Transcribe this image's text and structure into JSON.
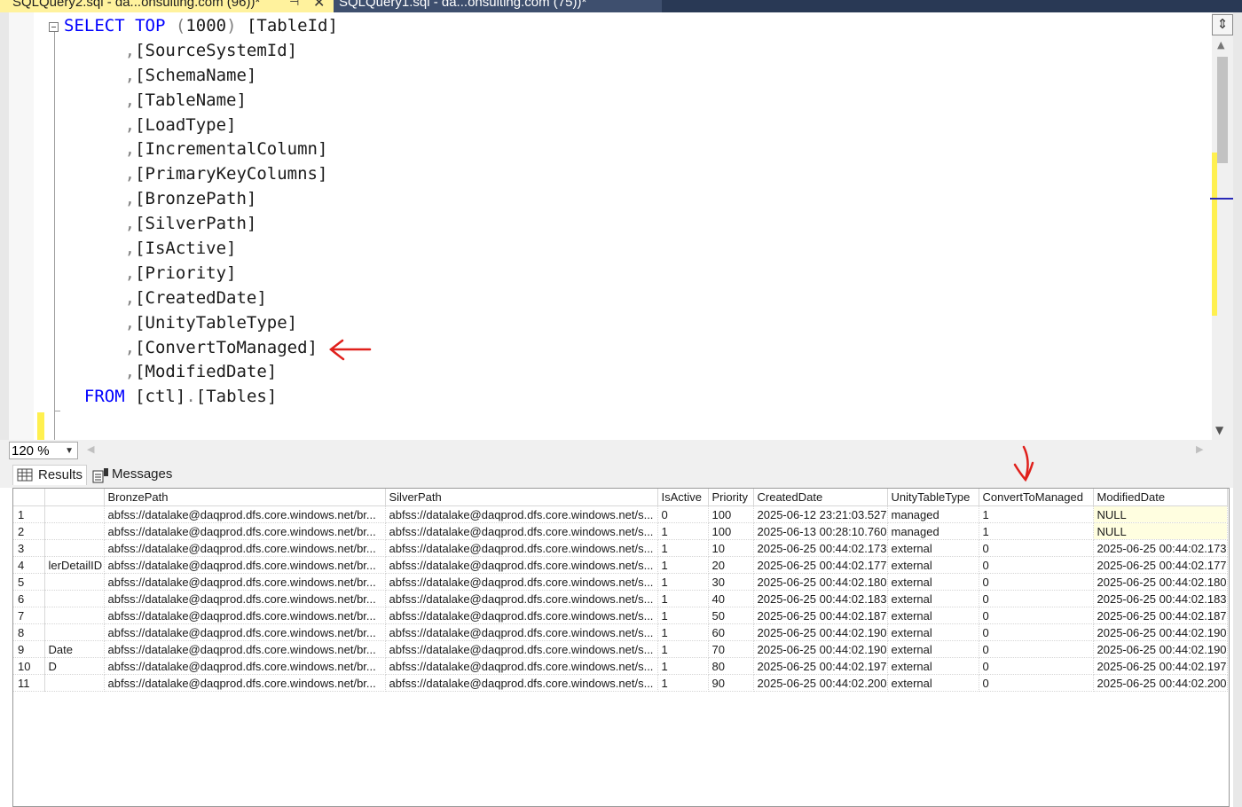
{
  "tabs": {
    "active": {
      "title": "SQLQuery2.sql - da...onsulting.com (96))*",
      "pin": "⊣",
      "close": "✕"
    },
    "inactive": {
      "title": "SQLQuery1.sql - da...onsulting.com (75))*"
    }
  },
  "editor": {
    "lines": [
      {
        "kw": "SELECT",
        "mid": " ",
        "kw2": "TOP",
        "gray": " (",
        "text": "1000",
        "gray2": ")",
        "tail": " [TableId]",
        "indent": ""
      },
      {
        "comma": ",",
        "text": "[SourceSystemId]"
      },
      {
        "comma": ",",
        "text": "[SchemaName]"
      },
      {
        "comma": ",",
        "text": "[TableName]"
      },
      {
        "comma": ",",
        "text": "[LoadType]"
      },
      {
        "comma": ",",
        "text": "[IncrementalColumn]"
      },
      {
        "comma": ",",
        "text": "[PrimaryKeyColumns]"
      },
      {
        "comma": ",",
        "text": "[BronzePath]"
      },
      {
        "comma": ",",
        "text": "[SilverPath]"
      },
      {
        "comma": ",",
        "text": "[IsActive]"
      },
      {
        "comma": ",",
        "text": "[Priority]"
      },
      {
        "comma": ",",
        "text": "[CreatedDate]"
      },
      {
        "comma": ",",
        "text": "[UnityTableType]"
      },
      {
        "comma": ",",
        "text": "[ConvertToManaged]"
      },
      {
        "comma": ",",
        "text": "[ModifiedDate]"
      },
      {
        "kw": "FROM",
        "text": "[ctl]",
        "dot": ".",
        "text2": "[Tables]"
      }
    ],
    "zoom": "120 %"
  },
  "results": {
    "tabs": {
      "results": "Results",
      "messages": "Messages"
    },
    "columns": [
      "",
      "",
      "BronzePath",
      "SilverPath",
      "IsActive",
      "Priority",
      "CreatedDate",
      "UnityTableType",
      "ConvertToManaged",
      "ModifiedDate"
    ],
    "rows": [
      [
        "1",
        "",
        "abfss://datalake@daqprod.dfs.core.windows.net/br...",
        "abfss://datalake@daqprod.dfs.core.windows.net/s...",
        "0",
        "100",
        "2025-06-12 23:21:03.527",
        "managed",
        "1",
        "NULL"
      ],
      [
        "2",
        "",
        "abfss://datalake@daqprod.dfs.core.windows.net/br...",
        "abfss://datalake@daqprod.dfs.core.windows.net/s...",
        "1",
        "100",
        "2025-06-13 00:28:10.760",
        "managed",
        "1",
        "NULL"
      ],
      [
        "3",
        "",
        "abfss://datalake@daqprod.dfs.core.windows.net/br...",
        "abfss://datalake@daqprod.dfs.core.windows.net/s...",
        "1",
        "10",
        "2025-06-25 00:44:02.173",
        "external",
        "0",
        "2025-06-25 00:44:02.173"
      ],
      [
        "4",
        "lerDetailID",
        "abfss://datalake@daqprod.dfs.core.windows.net/br...",
        "abfss://datalake@daqprod.dfs.core.windows.net/s...",
        "1",
        "20",
        "2025-06-25 00:44:02.177",
        "external",
        "0",
        "2025-06-25 00:44:02.177"
      ],
      [
        "5",
        "",
        "abfss://datalake@daqprod.dfs.core.windows.net/br...",
        "abfss://datalake@daqprod.dfs.core.windows.net/s...",
        "1",
        "30",
        "2025-06-25 00:44:02.180",
        "external",
        "0",
        "2025-06-25 00:44:02.180"
      ],
      [
        "6",
        "",
        "abfss://datalake@daqprod.dfs.core.windows.net/br...",
        "abfss://datalake@daqprod.dfs.core.windows.net/s...",
        "1",
        "40",
        "2025-06-25 00:44:02.183",
        "external",
        "0",
        "2025-06-25 00:44:02.183"
      ],
      [
        "7",
        "",
        "abfss://datalake@daqprod.dfs.core.windows.net/br...",
        "abfss://datalake@daqprod.dfs.core.windows.net/s...",
        "1",
        "50",
        "2025-06-25 00:44:02.187",
        "external",
        "0",
        "2025-06-25 00:44:02.187"
      ],
      [
        "8",
        "",
        "abfss://datalake@daqprod.dfs.core.windows.net/br...",
        "abfss://datalake@daqprod.dfs.core.windows.net/s...",
        "1",
        "60",
        "2025-06-25 00:44:02.190",
        "external",
        "0",
        "2025-06-25 00:44:02.190"
      ],
      [
        "9",
        "Date",
        "abfss://datalake@daqprod.dfs.core.windows.net/br...",
        "abfss://datalake@daqprod.dfs.core.windows.net/s...",
        "1",
        "70",
        "2025-06-25 00:44:02.190",
        "external",
        "0",
        "2025-06-25 00:44:02.190"
      ],
      [
        "10",
        "D",
        "abfss://datalake@daqprod.dfs.core.windows.net/br...",
        "abfss://datalake@daqprod.dfs.core.windows.net/s...",
        "1",
        "80",
        "2025-06-25 00:44:02.197",
        "external",
        "0",
        "2025-06-25 00:44:02.197"
      ],
      [
        "11",
        "",
        "abfss://datalake@daqprod.dfs.core.windows.net/br...",
        "abfss://datalake@daqprod.dfs.core.windows.net/s...",
        "1",
        "90",
        "2025-06-25 00:44:02.200",
        "external",
        "0",
        "2025-06-25 00:44:02.200"
      ]
    ]
  },
  "colors": {
    "keyword": "#0000ff",
    "tab_active_bg": "#fff29d",
    "tab_bar_bg": "#293955",
    "annotation": "#e0201c",
    "change_marker": "#fff04f"
  }
}
